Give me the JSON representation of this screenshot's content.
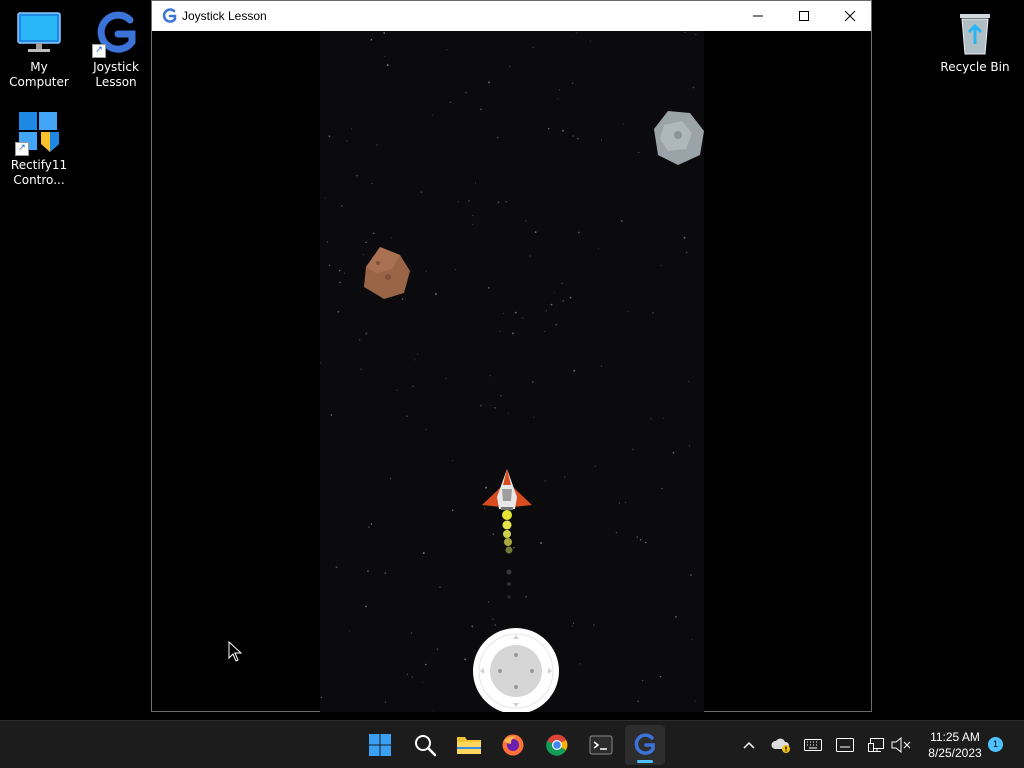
{
  "desktop": {
    "icons": [
      {
        "label": "My Computer",
        "icon": "monitor-icon"
      },
      {
        "label": "Joystick\nLesson",
        "icon": "gdevelop-icon"
      },
      {
        "label": "Rectify11\nContro...",
        "icon": "control-panel-icon"
      },
      {
        "label": "Recycle Bin",
        "icon": "recycle-bin-icon"
      }
    ]
  },
  "window": {
    "title": "Joystick Lesson",
    "minimize_glyph": "—",
    "maximize_glyph": "☐",
    "close_glyph": "✕"
  },
  "game": {
    "background": "#0b0b0e",
    "asteroids": [
      {
        "kind": "brown-asteroid",
        "color": "#9a6546"
      },
      {
        "kind": "grey-asteroid",
        "color": "#9aa3a8"
      }
    ],
    "ship": {
      "body_color": "#e0e0e0",
      "wing_color": "#d84d1f",
      "flame_color": "#e6e634"
    },
    "joystick": {
      "ring_color": "#ffffff",
      "thumb_color": "#d6d6d6"
    }
  },
  "taskbar": {
    "apps": [
      {
        "name": "start-button",
        "icon": "windows-logo-icon"
      },
      {
        "name": "search-button",
        "icon": "search-icon"
      },
      {
        "name": "file-explorer-button",
        "icon": "folder-icon"
      },
      {
        "name": "firefox-button",
        "icon": "firefox-icon"
      },
      {
        "name": "chrome-button",
        "icon": "chrome-icon"
      },
      {
        "name": "terminal-button",
        "icon": "terminal-icon"
      },
      {
        "name": "joystick-lesson-button",
        "icon": "gdevelop-icon"
      }
    ],
    "tray": {
      "chevron": "^",
      "time": "11:25 AM",
      "date": "8/25/2023",
      "notification_count": "1"
    },
    "accent": "#4cc2ff"
  }
}
